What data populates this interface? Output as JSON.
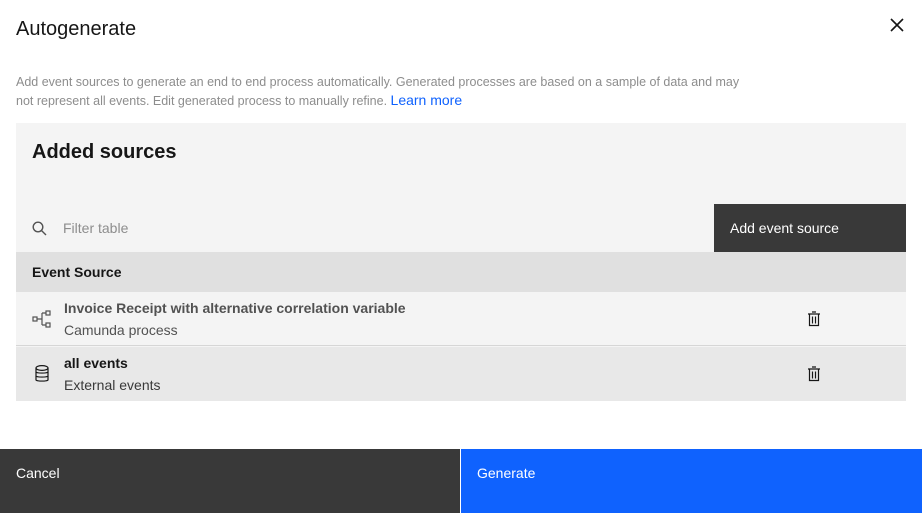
{
  "modal": {
    "title": "Autogenerate",
    "description": "Add event sources to generate an end to end process automatically. Generated processes are based on a sample of data and may not represent all events. Edit generated process to manually refine.",
    "learn_more": "Learn more"
  },
  "sources": {
    "title": "Added sources",
    "search_placeholder": "Filter table",
    "add_label": "Add event source",
    "column_header": "Event Source",
    "rows": [
      {
        "name": "Invoice Receipt with alternative correlation variable",
        "type": "Camunda process",
        "icon": "process-flow-icon"
      },
      {
        "name": "all events",
        "type": "External events",
        "icon": "database-icon"
      }
    ]
  },
  "footer": {
    "cancel_label": "Cancel",
    "generate_label": "Generate"
  },
  "colors": {
    "primary": "#0f62fe",
    "dark": "#393939",
    "panel": "#f4f4f4",
    "header": "#e0e0e0"
  }
}
